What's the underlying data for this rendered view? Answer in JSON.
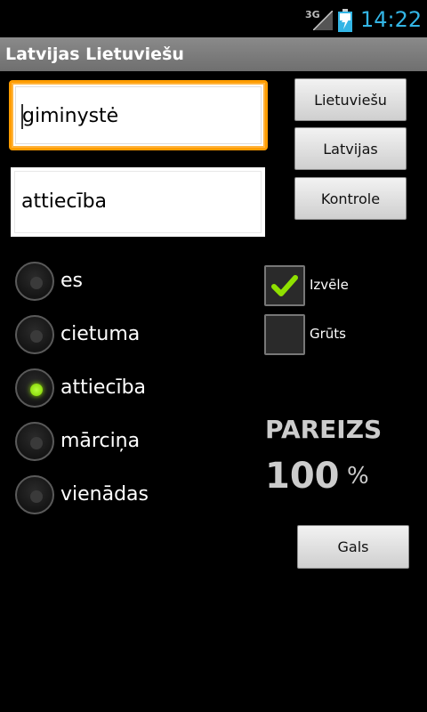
{
  "status_bar": {
    "network": "3G",
    "time": "14:22"
  },
  "app": {
    "title": "Latvijas Lietuviešu"
  },
  "input": {
    "value": "giminystė"
  },
  "output": {
    "value": "attiecība"
  },
  "buttons": {
    "lithuanian": "Lietuviešu",
    "latvian": "Latvijas",
    "check": "Kontrole",
    "end": "Gals"
  },
  "options": [
    {
      "label": "es",
      "selected": false
    },
    {
      "label": "cietuma",
      "selected": false
    },
    {
      "label": "attiecība",
      "selected": true
    },
    {
      "label": "mārciņa",
      "selected": false
    },
    {
      "label": "vienādas",
      "selected": false
    }
  ],
  "checkboxes": [
    {
      "label": "Izvēle",
      "checked": true
    },
    {
      "label": "Grūts",
      "checked": false
    }
  ],
  "score": {
    "title": "PAREIZS",
    "value": "100",
    "unit": "%"
  },
  "colors": {
    "accent": "#33b5e5",
    "focus": "#ff9c00",
    "radio_on": "#8fe000",
    "check": "#8fe000"
  }
}
